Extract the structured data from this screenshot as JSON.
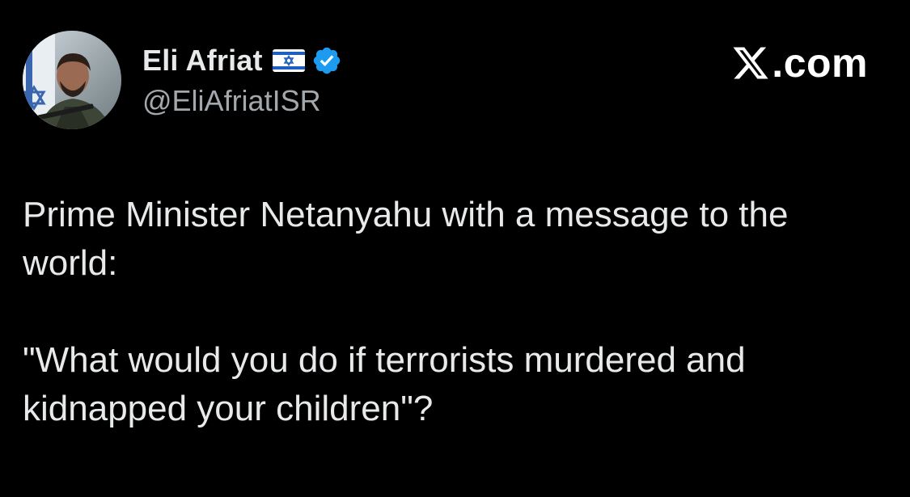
{
  "tweet": {
    "author": {
      "name": "Eli Afriat",
      "flag_icon": "israel-flag-icon",
      "verified_icon": "verified-badge-icon",
      "verified_color": "#1d9bf0",
      "handle": "@EliAfriatISR",
      "avatar_icon": "avatar-photo"
    },
    "watermark": {
      "logo_icon": "x-logo-icon",
      "text": ".com"
    },
    "body": {
      "paragraphs": [
        "Prime Minister Netanyahu with a message to the world:",
        "\"What would you do if terrorists murdered and kidnapped your children\"?"
      ]
    }
  },
  "colors": {
    "background": "#000000",
    "text_primary": "#e7e9ea",
    "text_secondary": "#a3a8ad",
    "verified": "#1d9bf0"
  }
}
